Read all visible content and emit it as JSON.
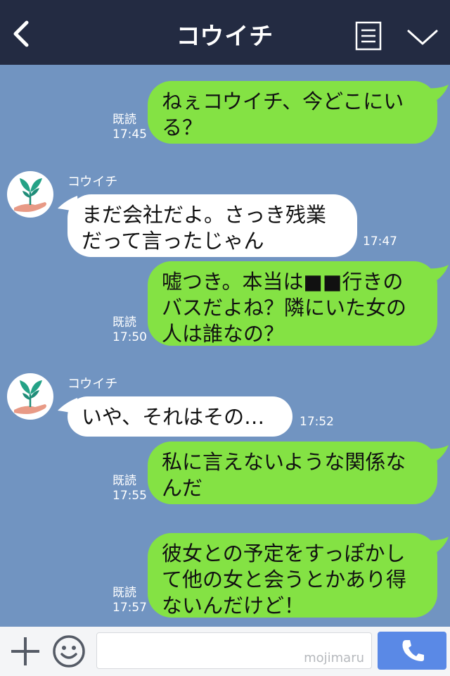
{
  "header": {
    "title": "コウイチ",
    "back_icon": "chevron-left-icon",
    "menu_icon": "list-icon",
    "expand_icon": "chevron-down-icon",
    "background": "#232b42"
  },
  "chat": {
    "background": "#7194c1",
    "outgoing_color": "#84e244",
    "incoming_color": "#ffffff",
    "messages": [
      {
        "direction": "outgoing",
        "text": "ねぇコウイチ、今どこにいる？",
        "read_label": "既読",
        "time": "17:45"
      },
      {
        "direction": "incoming",
        "sender": "コウイチ",
        "text": "まだ会社だよ。さっき残業だって言ったじゃん",
        "time": "17:47"
      },
      {
        "direction": "outgoing",
        "text": "嘘つき。本当は■■行きのバスだよね？隣にいた女の人は誰なの？",
        "read_label": "既読",
        "time": "17:50"
      },
      {
        "direction": "incoming",
        "sender": "コウイチ",
        "text": "いや、それはその…",
        "time": "17:52"
      },
      {
        "direction": "outgoing",
        "text": "私に言えないような関係なんだ",
        "read_label": "既読",
        "time": "17:55"
      },
      {
        "direction": "outgoing",
        "text": "彼女との予定をすっぽかして他の女と会うとかあり得ないんだけど！",
        "read_label": "既読",
        "time": "17:57"
      }
    ]
  },
  "footer": {
    "add_icon": "plus-icon",
    "emoji_icon": "smiley-icon",
    "input_value": "",
    "watermark": "mojimaru",
    "call_icon": "phone-icon",
    "call_color": "#5a89e6"
  }
}
